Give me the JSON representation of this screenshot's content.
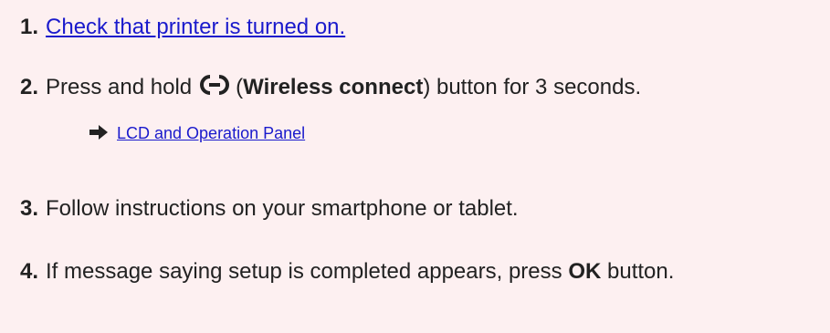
{
  "steps": [
    {
      "number": "1.",
      "link_text": "Check that printer is turned on."
    },
    {
      "number": "2.",
      "text_before": "Press and hold",
      "paren_open": "(",
      "bold": "Wireless connect",
      "text_after": ") button for 3 seconds.",
      "icon": "wireless-connect-icon"
    },
    {
      "number": "3.",
      "text": "Follow instructions on your smartphone or tablet."
    },
    {
      "number": "4.",
      "text_before": "If message saying setup is completed appears, press",
      "bold": "OK",
      "text_after": "button."
    }
  ],
  "sublink": {
    "icon": "arrow-right-icon",
    "text": "LCD and Operation Panel"
  },
  "colors": {
    "background": "#fdf0f1",
    "link": "#1a1acc",
    "text": "#222222"
  }
}
